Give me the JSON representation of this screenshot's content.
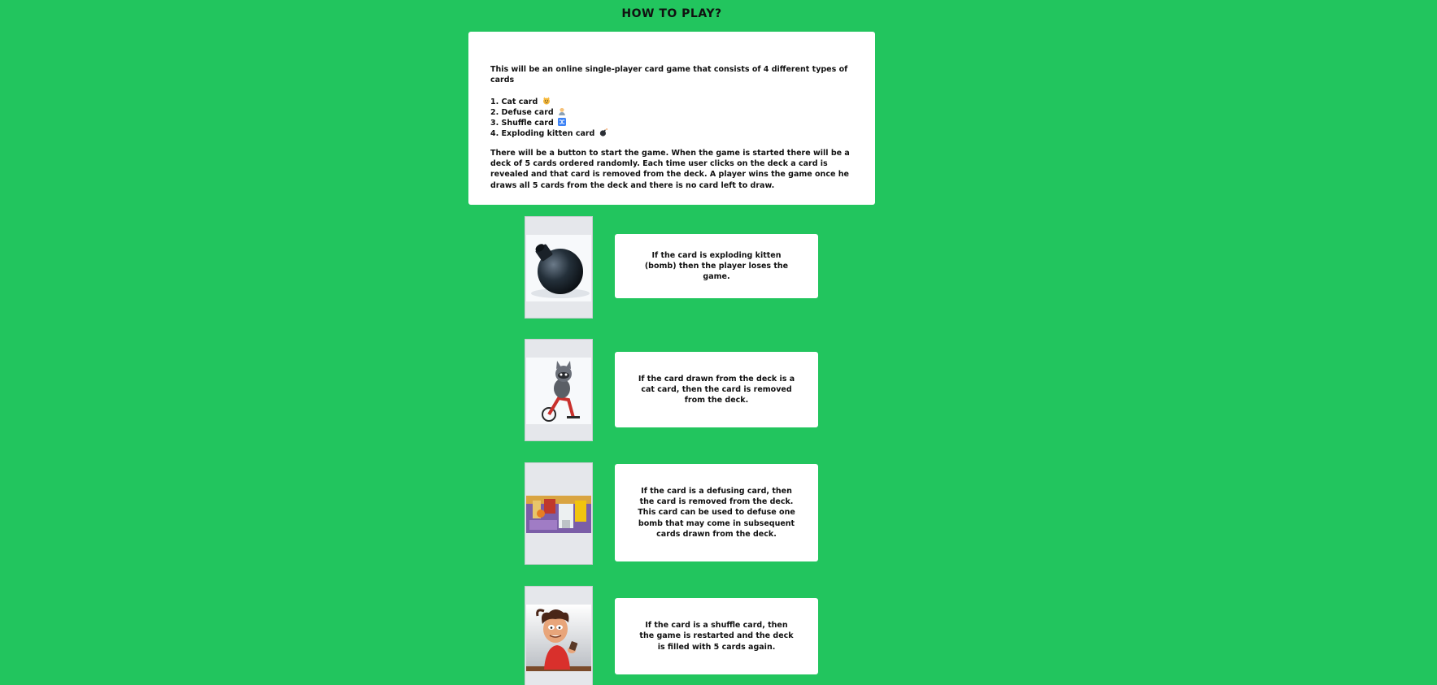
{
  "page": {
    "title": "How to play?"
  },
  "intro": {
    "lead": "This will be an online single-player card game that consists of 4 different types of cards",
    "card_types": [
      {
        "label": "1. Cat card",
        "icon": "cat-emoji-icon"
      },
      {
        "label": "2. Defuse card",
        "icon": "person-emoji-icon"
      },
      {
        "label": "3. Shuffle card",
        "icon": "shuffle-emoji-icon"
      },
      {
        "label": "4. Exploding kitten card",
        "icon": "bomb-emoji-icon"
      }
    ],
    "description": "There will be a button to start the game. When the game is started there will be a deck of 5 cards ordered randomly. Each time user clicks on the deck a card is revealed and that card is removed from the deck. A player wins the game once he draws all 5 cards from the deck and there is no card left to draw."
  },
  "cards": [
    {
      "image": "bomb-card-image",
      "text": "If the card is exploding kitten (bomb) then the player loses the game."
    },
    {
      "image": "cat-card-image",
      "text": "If the card drawn from the deck is a cat card, then the card is removed from the deck."
    },
    {
      "image": "defuse-card-image",
      "text": "If the card is a defusing card, then the card is removed from the deck. This card can be used to defuse one bomb that may come in subsequent cards drawn from the deck."
    },
    {
      "image": "shuffle-card-image",
      "text": "If the card is a shuffle card, then the game is restarted and the deck is filled with 5 cards again."
    }
  ],
  "colors": {
    "background": "#22c55e",
    "panel": "#ffffff",
    "card_frame": "#e5e7eb"
  }
}
